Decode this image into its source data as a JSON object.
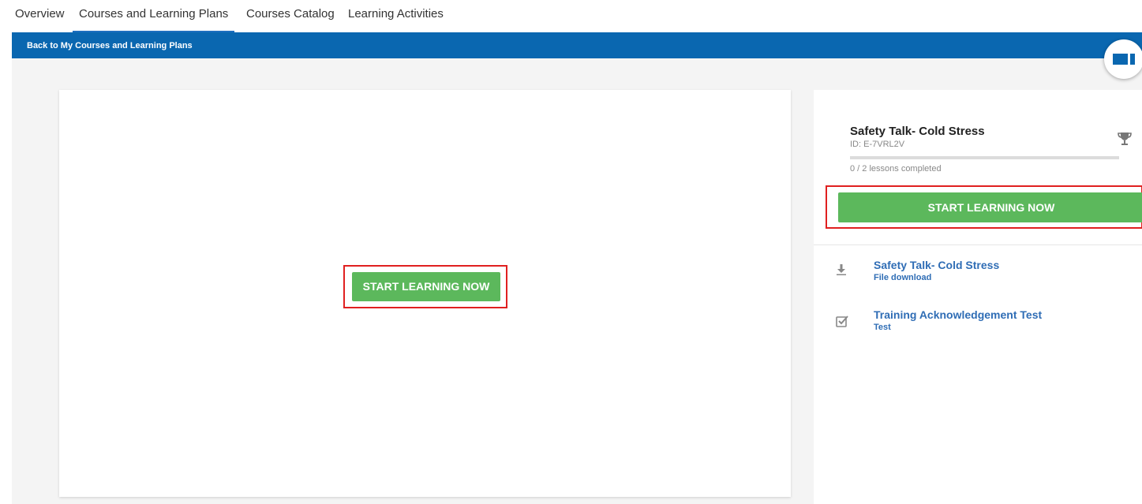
{
  "nav": {
    "tabs": [
      {
        "label": "Overview",
        "active": false
      },
      {
        "label": "Courses and Learning Plans",
        "active": true
      },
      {
        "label": "Courses Catalog",
        "active": false
      },
      {
        "label": "Learning Activities",
        "active": false
      }
    ]
  },
  "breadcrumb": {
    "back_label": "Back to My Courses and Learning Plans"
  },
  "player": {
    "start_label": "START LEARNING NOW"
  },
  "course": {
    "title": "Safety Talk- Cold Stress",
    "id_text": "ID: E-7VRL2V",
    "progress_fraction": 0,
    "progress_text": "0 / 2 lessons completed",
    "start_label": "START LEARNING NOW"
  },
  "lessons": [
    {
      "name": "Safety Talk- Cold Stress",
      "type": "File download",
      "icon": "download-icon"
    },
    {
      "name": "Training Acknowledgement Test",
      "type": "Test",
      "icon": "checkbox-icon"
    }
  ],
  "colors": {
    "accent_blue": "#0a67b0",
    "start_green": "#5cb85c",
    "highlight_red": "#e02020",
    "link_blue": "#2f6db5"
  }
}
